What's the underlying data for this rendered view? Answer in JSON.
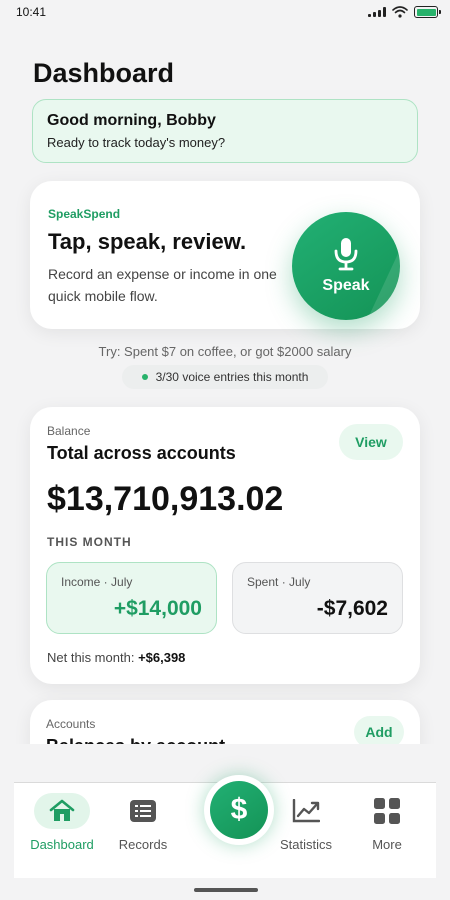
{
  "status": {
    "time": "10:41"
  },
  "page": {
    "title": "Dashboard"
  },
  "greeting": {
    "title": "Good morning, Bobby",
    "subtitle": "Ready to track today's money?"
  },
  "speak_card": {
    "brand": "SpeakSpend",
    "title": "Tap, speak, review.",
    "description": "Record an expense or income in one quick mobile flow.",
    "button_label": "Speak"
  },
  "hint": {
    "text": "Try: Spent $7 on coffee, or got $2000 salary"
  },
  "voice_usage": {
    "text": "3/30 voice entries this month"
  },
  "balance": {
    "label": "Balance",
    "title": "Total across accounts",
    "view_label": "View",
    "amount": "$13,710,913.02",
    "month_label": "THIS MONTH",
    "income_label": "Income · July",
    "income_value": "+$14,000",
    "spent_label": "Spent · July",
    "spent_value": "-$7,602",
    "net_label": "Net this month:",
    "net_value": "+$6,398"
  },
  "accounts": {
    "label": "Accounts",
    "title": "Balances by account",
    "add_label": "Add"
  },
  "nav": {
    "items": [
      {
        "label": "Dashboard",
        "icon": "home-icon",
        "active": true
      },
      {
        "label": "Records",
        "icon": "records-icon",
        "active": false
      },
      {
        "label": "Statistics",
        "icon": "chart-icon",
        "active": false
      },
      {
        "label": "More",
        "icon": "grid-icon",
        "active": false
      }
    ],
    "fab_symbol": "$"
  },
  "colors": {
    "accent": "#1f9d63",
    "accent_light": "#e9f8ef",
    "background": "#f3f3f4"
  }
}
